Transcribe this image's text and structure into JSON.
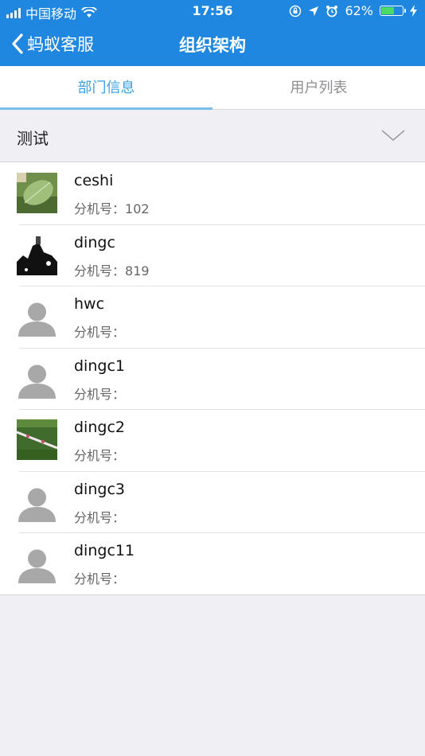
{
  "status_bar": {
    "carrier": "中国移动",
    "time": "17:56",
    "battery_percent": "62%",
    "battery_level": 0.62
  },
  "nav": {
    "back_label": "蚂蚁客服",
    "title": "组织架构"
  },
  "tabs": [
    {
      "label": "部门信息",
      "active": true
    },
    {
      "label": "用户列表",
      "active": false
    }
  ],
  "department": {
    "name": "测试"
  },
  "users": [
    {
      "name": "ceshi",
      "ext_label": "分机号：",
      "ext": "102",
      "avatar": "leaf-photo"
    },
    {
      "name": "dingc",
      "ext_label": "分机号：",
      "ext": "819",
      "avatar": "bw-photo"
    },
    {
      "name": "hwc",
      "ext_label": "分机号：",
      "ext": "",
      "avatar": "default-person"
    },
    {
      "name": "dingc1",
      "ext_label": "分机号：",
      "ext": "",
      "avatar": "default-person"
    },
    {
      "name": "dingc2",
      "ext_label": "分机号：",
      "ext": "",
      "avatar": "grass-photo"
    },
    {
      "name": "dingc3",
      "ext_label": "分机号：",
      "ext": "",
      "avatar": "default-person"
    },
    {
      "name": "dingc11",
      "ext_label": "分机号：",
      "ext": "",
      "avatar": "default-person"
    }
  ],
  "colors": {
    "nav_blue": "#1f87e0",
    "tab_active": "#3aa0e4",
    "background": "#efeff4"
  }
}
